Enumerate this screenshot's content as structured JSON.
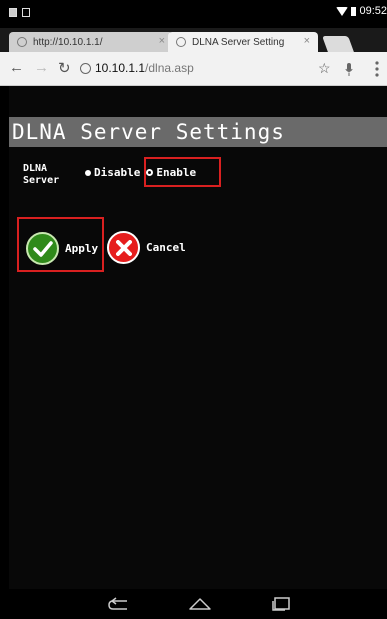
{
  "status_bar": {
    "time": "09:52"
  },
  "browser": {
    "tabs": [
      {
        "label": "http://10.10.1.1/",
        "active": false
      },
      {
        "label": "DLNA Server Setting",
        "active": true
      }
    ],
    "url_host": "10.10.1.1",
    "url_path": "/dlna.asp"
  },
  "page": {
    "title": "DLNA Server Settings",
    "dlna_label_line1": "DLNA",
    "dlna_label_line2": "Server",
    "options": [
      {
        "label": "Disable",
        "selected": false
      },
      {
        "label": "Enable",
        "selected": true
      }
    ],
    "apply_label": "Apply",
    "cancel_label": "Cancel"
  },
  "colors": {
    "highlight_box": "#d92020",
    "apply_icon": "#2f8a1a",
    "cancel_icon": "#e61e1e",
    "title_band": "#6a6a6a"
  }
}
